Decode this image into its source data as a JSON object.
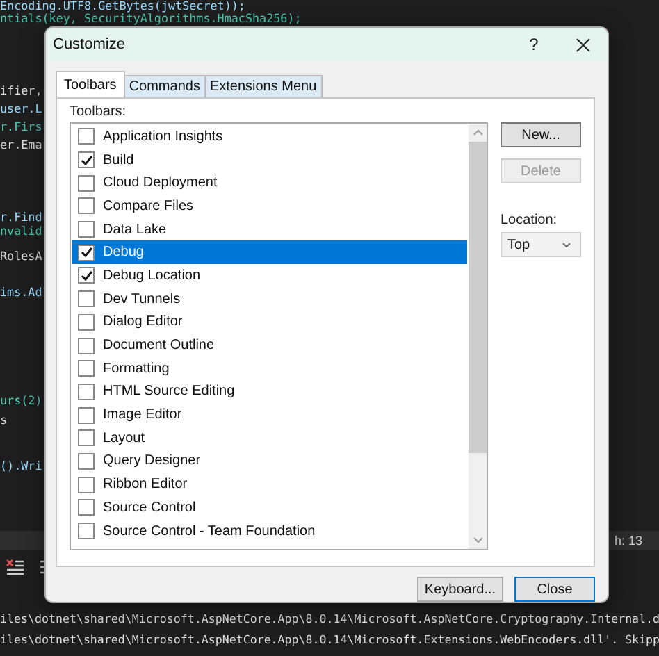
{
  "editor": {
    "lines": [
      "Encoding.UTF8.GetBytes(jwtSecret));",
      "ntials(key, SecurityAlgorithms.HmacSha256);",
      "ifier,",
      "user.L",
      "r.Firs",
      "er.Ema",
      "r.Find",
      "nvalid",
      "RolesA",
      "ims.Ad",
      "urs(2)",
      "s",
      "().Wri"
    ],
    "status": "h: 13"
  },
  "output": {
    "lines": [
      "iles\\dotnet\\shared\\Microsoft.AspNetCore.App\\8.0.14\\Microsoft.AspNetCore.Cryptography.Internal.d",
      "iles\\dotnet\\shared\\Microsoft.AspNetCore.App\\8.0.14\\Microsoft.Extensions.WebEncoders.dll'. Skipp"
    ]
  },
  "dialog": {
    "title": "Customize",
    "help": "?",
    "tabs": [
      {
        "label": "Toolbars",
        "selected": true
      },
      {
        "label": "Commands",
        "selected": false
      },
      {
        "label": "Extensions Menu",
        "selected": false
      }
    ],
    "list_label": "Toolbars:",
    "toolbars": [
      {
        "label": "Application Insights",
        "checked": false,
        "selected": false
      },
      {
        "label": "Build",
        "checked": true,
        "selected": false
      },
      {
        "label": "Cloud Deployment",
        "checked": false,
        "selected": false
      },
      {
        "label": "Compare Files",
        "checked": false,
        "selected": false
      },
      {
        "label": "Data Lake",
        "checked": false,
        "selected": false
      },
      {
        "label": "Debug",
        "checked": true,
        "selected": true
      },
      {
        "label": "Debug Location",
        "checked": true,
        "selected": false
      },
      {
        "label": "Dev Tunnels",
        "checked": false,
        "selected": false
      },
      {
        "label": "Dialog Editor",
        "checked": false,
        "selected": false
      },
      {
        "label": "Document Outline",
        "checked": false,
        "selected": false
      },
      {
        "label": "Formatting",
        "checked": false,
        "selected": false
      },
      {
        "label": "HTML Source Editing",
        "checked": false,
        "selected": false
      },
      {
        "label": "Image Editor",
        "checked": false,
        "selected": false
      },
      {
        "label": "Layout",
        "checked": false,
        "selected": false
      },
      {
        "label": "Query Designer",
        "checked": false,
        "selected": false
      },
      {
        "label": "Ribbon Editor",
        "checked": false,
        "selected": false
      },
      {
        "label": "Source Control",
        "checked": false,
        "selected": false
      },
      {
        "label": "Source Control - Team Foundation",
        "checked": false,
        "selected": false
      }
    ],
    "side_buttons": [
      {
        "label": "New...",
        "disabled": false
      },
      {
        "label": "Delete",
        "disabled": true
      }
    ],
    "location": {
      "label": "Location:",
      "value": "Top"
    },
    "footer_buttons": [
      {
        "label": "Keyboard...",
        "default": false
      },
      {
        "label": "Close",
        "default": true
      }
    ]
  }
}
